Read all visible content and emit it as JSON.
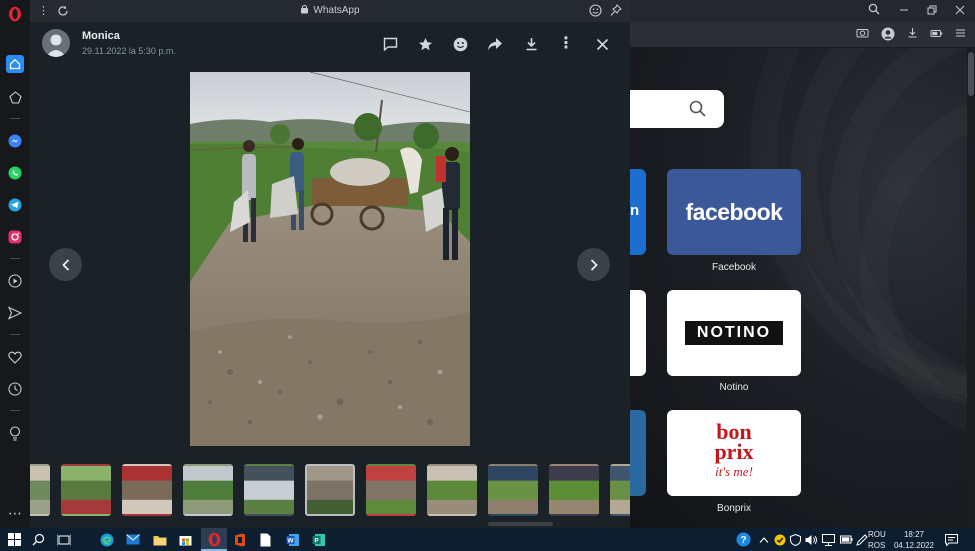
{
  "whatsapp": {
    "window_title": "WhatsApp",
    "sender": {
      "name": "Monica",
      "timestamp": "29.11.2022 la 5:30 p.m."
    },
    "header_actions": [
      "go-to-message",
      "star",
      "react",
      "forward",
      "download",
      "menu",
      "close"
    ],
    "thumbnails_count": 12,
    "active_thumbnail": 5
  },
  "speed_dial": {
    "search_placeholder": "",
    "tiles": [
      {
        "label": "Facebook",
        "logo_text": "facebook",
        "bg": "#3b5998"
      },
      {
        "label": "Notino",
        "logo_text": "NOTINO",
        "bg": "#ffffff"
      },
      {
        "label": "Bonprix",
        "logo_text_1": "bon",
        "logo_text_2": "prix",
        "logo_text_3": "it's me!",
        "bg": "#ffffff"
      }
    ]
  },
  "taskbar": {
    "language_top": "ROU",
    "language_bottom": "ROS",
    "time": "18:27",
    "date": "04.12.2022"
  },
  "colors": {
    "opera_red": "#e3262f",
    "whatsapp_dark": "#1b2227",
    "taskbar": "#0c1e2f",
    "facebook_blue": "#3b5998",
    "bonprix_red": "#c4161c"
  }
}
